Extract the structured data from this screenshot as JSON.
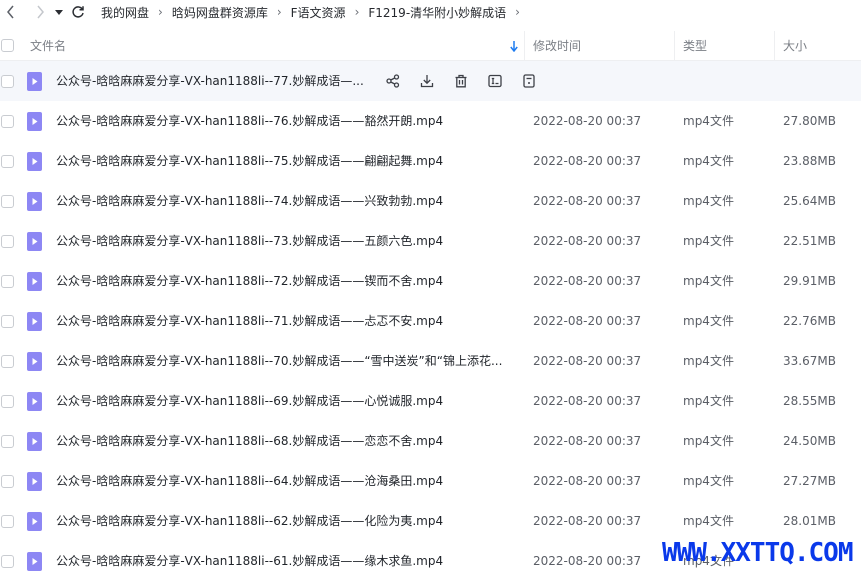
{
  "nav": {
    "breadcrumbs": [
      "我的网盘",
      "晗妈网盘群资源库",
      "F语文资源",
      "F1219-清华附小妙解成语"
    ]
  },
  "columns": {
    "name": "文件名",
    "modified": "修改时间",
    "type": "类型",
    "size": "大小"
  },
  "hover_actions": [
    "share-icon",
    "download-icon",
    "delete-icon",
    "rename-icon",
    "more-icon"
  ],
  "files": [
    {
      "name": "公众号-晗晗麻麻爱分享-VX-han1188li--77.妙解成语—...",
      "modified": "",
      "type": "",
      "size": ""
    },
    {
      "name": "公众号-晗晗麻麻爱分享-VX-han1188li--76.妙解成语——豁然开朗.mp4",
      "modified": "2022-08-20 00:37",
      "type": "mp4文件",
      "size": "27.80MB"
    },
    {
      "name": "公众号-晗晗麻麻爱分享-VX-han1188li--75.妙解成语——翩翩起舞.mp4",
      "modified": "2022-08-20 00:37",
      "type": "mp4文件",
      "size": "23.88MB"
    },
    {
      "name": "公众号-晗晗麻麻爱分享-VX-han1188li--74.妙解成语——兴致勃勃.mp4",
      "modified": "2022-08-20 00:37",
      "type": "mp4文件",
      "size": "25.64MB"
    },
    {
      "name": "公众号-晗晗麻麻爱分享-VX-han1188li--73.妙解成语——五颜六色.mp4",
      "modified": "2022-08-20 00:37",
      "type": "mp4文件",
      "size": "22.51MB"
    },
    {
      "name": "公众号-晗晗麻麻爱分享-VX-han1188li--72.妙解成语——锲而不舍.mp4",
      "modified": "2022-08-20 00:37",
      "type": "mp4文件",
      "size": "29.91MB"
    },
    {
      "name": "公众号-晗晗麻麻爱分享-VX-han1188li--71.妙解成语——忐忑不安.mp4",
      "modified": "2022-08-20 00:37",
      "type": "mp4文件",
      "size": "22.76MB"
    },
    {
      "name": "公众号-晗晗麻麻爱分享-VX-han1188li--70.妙解成语——“雪中送炭”和“锦上添花...",
      "modified": "2022-08-20 00:37",
      "type": "mp4文件",
      "size": "33.67MB"
    },
    {
      "name": "公众号-晗晗麻麻爱分享-VX-han1188li--69.妙解成语——心悦诚服.mp4",
      "modified": "2022-08-20 00:37",
      "type": "mp4文件",
      "size": "28.55MB"
    },
    {
      "name": "公众号-晗晗麻麻爱分享-VX-han1188li--68.妙解成语——恋恋不舍.mp4",
      "modified": "2022-08-20 00:37",
      "type": "mp4文件",
      "size": "24.50MB"
    },
    {
      "name": "公众号-晗晗麻麻爱分享-VX-han1188li--64.妙解成语——沧海桑田.mp4",
      "modified": "2022-08-20 00:37",
      "type": "mp4文件",
      "size": "27.27MB"
    },
    {
      "name": "公众号-晗晗麻麻爱分享-VX-han1188li--62.妙解成语——化险为夷.mp4",
      "modified": "2022-08-20 00:37",
      "type": "mp4文件",
      "size": "28.01MB"
    },
    {
      "name": "公众号-晗晗麻麻爱分享-VX-han1188li--61.妙解成语——缘木求鱼.mp4",
      "modified": "2022-08-20 00:37",
      "type": "mp4文件",
      "size": ""
    }
  ],
  "watermark": "WWW.XXTTQ.COM",
  "colors": {
    "accent": "#1e7cf0",
    "file_icon": "#8d87f4",
    "watermark": "#0a39ea"
  }
}
